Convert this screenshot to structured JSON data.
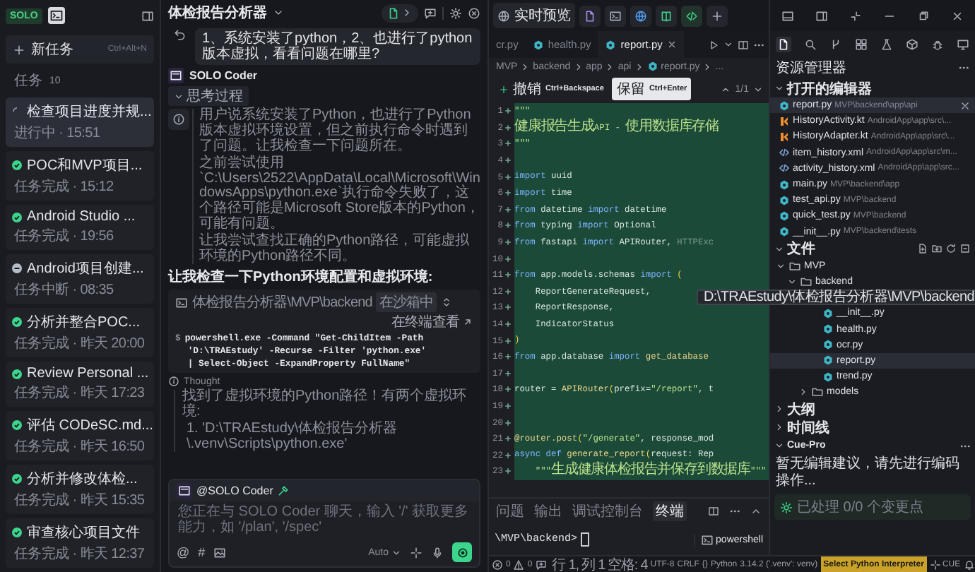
{
  "sidebar": {
    "logo": "SOLO",
    "new_task": {
      "label": "新任务",
      "shortcut": "Ctrl+Alt+N"
    },
    "tasks_label": "任务",
    "tasks_count": "10",
    "tasks": [
      {
        "title": "检查项目进度并规...",
        "status": "进行中 · 15:51",
        "kind": "running",
        "selected": true
      },
      {
        "title": "POC和MVP项目...",
        "status": "任务完成 · 15:12",
        "kind": "done",
        "selected": false
      },
      {
        "title": "Android Studio ...",
        "status": "任务完成 · 19:56",
        "kind": "done",
        "selected": false
      },
      {
        "title": "Android项目创建...",
        "status": "任务中断 · 08:35",
        "kind": "stopped",
        "selected": false
      },
      {
        "title": "分析并整合POC...",
        "status": "任务完成 · 昨天 20:00",
        "kind": "done",
        "selected": false
      },
      {
        "title": "Review Personal ...",
        "status": "任务完成 · 昨天 17:23",
        "kind": "done",
        "selected": false
      },
      {
        "title": "评估 CODeSC.md...",
        "status": "任务完成 · 昨天 16:50",
        "kind": "done",
        "selected": false
      },
      {
        "title": "分析并修改体检...",
        "status": "任务完成 · 昨天 15:35",
        "kind": "done",
        "selected": false
      },
      {
        "title": "审查核心项目文件",
        "status": "任务完成 · 昨天 12:37",
        "kind": "done",
        "selected": false
      }
    ]
  },
  "chat": {
    "title": "体检报告分析器",
    "user_message": "1、系统安装了python，2、也进行了python版本虚拟，看看问题在哪里?",
    "agent": "SOLO Coder",
    "thinking": {
      "label": "思考过程",
      "expanded": true,
      "paragraphs": [
        "用户说系统安装了Python，也进行了Python版本虚拟环境设置，但之前执行命令时遇到了问题。让我检查一下问题所在。",
        "之前尝试使用`C:\\Users\\2522\\AppData\\Local\\Microsoft\\WindowsApps\\python.exe`执行命令失败了，这个路径可能是Microsoft Store版本的Python，可能有问题。",
        "让我尝试查找正确的Python路径，可能虚拟环境的Python路径不同。"
      ]
    },
    "message": "让我检查一下Python环境配置和虚拟环境:",
    "terminal": {
      "path": "体检报告分析器\\MVP\\backend",
      "badge": "在沙箱中",
      "open_label": "在终端查看",
      "prompt": "$",
      "command_lines": [
        "powershell.exe -Command \"Get-ChildItem -Path",
        "'D:\\TRAEstudy' -Recurse -Filter 'python.exe'",
        "| Select-Object -ExpandProperty FullName\""
      ]
    },
    "thought": {
      "label": "Thought",
      "text": "找到了虚拟环境的Python路径！有两个虚拟环境:",
      "items": [
        "1. 'D:\\TRAEstudy\\体检报告分析器\\.venv\\Scripts\\python.exe'"
      ]
    },
    "input": {
      "mention": "@SOLO Coder",
      "placeholder": "您正在与 SOLO Coder 聊天，输入 '/' 获取更多能力，如 '/plan', '/spec'",
      "tools": [
        "@",
        "#"
      ],
      "mode": "Auto"
    }
  },
  "editor": {
    "preview": "实时预览",
    "tabs": [
      {
        "label": "cr.py",
        "selected": false
      },
      {
        "label": "health.py",
        "kind": "py",
        "selected": false
      },
      {
        "label": "report.py",
        "kind": "py",
        "selected": true
      }
    ],
    "breadcrumb": [
      "MVP",
      "backend",
      "app",
      "api",
      "report.py",
      "..."
    ],
    "diff": {
      "undo": "撤销",
      "undo_key": "Ctrl+Backspace",
      "keep": "保留",
      "keep_key": "Ctrl+Enter",
      "counter": "1/1"
    },
    "lines": [
      {
        "n": "1",
        "added": true,
        "segs": [
          {
            "kind": "str",
            "t": "\"\"\""
          }
        ]
      },
      {
        "n": "2",
        "added": true,
        "segs": [
          {
            "kind": "str",
            "t": "健康报告生成"
          },
          {
            "kind": "str",
            "t": "API - "
          },
          {
            "kind": "str",
            "t": "使用数据库存储"
          }
        ]
      },
      {
        "n": "3",
        "added": true,
        "segs": [
          {
            "kind": "str",
            "t": "\"\"\""
          }
        ]
      },
      {
        "n": "4",
        "added": true
      },
      {
        "n": "5",
        "added": true,
        "segs": [
          {
            "kind": "kw",
            "t": "import "
          },
          {
            "kind": "name",
            "t": "uuid"
          }
        ]
      },
      {
        "n": "6",
        "added": true,
        "segs": [
          {
            "kind": "kw",
            "t": "import "
          },
          {
            "kind": "name",
            "t": "time"
          }
        ]
      },
      {
        "n": "7",
        "added": true,
        "segs": [
          {
            "kind": "kw",
            "t": "from "
          },
          {
            "kind": "name",
            "t": "datetime "
          },
          {
            "kind": "kw",
            "t": "import "
          },
          {
            "kind": "name",
            "t": "datetime"
          }
        ]
      },
      {
        "n": "8",
        "added": true,
        "segs": [
          {
            "kind": "kw",
            "t": "from "
          },
          {
            "kind": "name",
            "t": "typing "
          },
          {
            "kind": "kw",
            "t": "import "
          },
          {
            "kind": "name",
            "t": "Optional"
          }
        ]
      },
      {
        "n": "9",
        "added": true,
        "segs": [
          {
            "kind": "kw",
            "t": "from "
          },
          {
            "kind": "name",
            "t": "fastapi "
          },
          {
            "kind": "kw",
            "t": "import "
          },
          {
            "kind": "name",
            "t": "APIRouter, "
          },
          {
            "kind": "dim",
            "t": "HTTPExc"
          }
        ]
      },
      {
        "n": "10",
        "added": true
      },
      {
        "n": "11",
        "added": true,
        "segs": [
          {
            "kind": "kw",
            "t": "from "
          },
          {
            "kind": "name",
            "t": "app.models.schemas "
          },
          {
            "kind": "kw",
            "t": "import "
          },
          {
            "kind": "punct",
            "t": "("
          }
        ]
      },
      {
        "n": "12",
        "added": true,
        "segs": [
          {
            "kind": "name",
            "t": "    ReportGenerateRequest,"
          }
        ]
      },
      {
        "n": "13",
        "added": true,
        "segs": [
          {
            "kind": "name",
            "t": "    ReportResponse,"
          }
        ]
      },
      {
        "n": "14",
        "added": true,
        "segs": [
          {
            "kind": "name",
            "t": "    IndicatorStatus"
          }
        ]
      },
      {
        "n": "15",
        "added": true,
        "segs": [
          {
            "kind": "punct",
            "t": ")"
          }
        ]
      },
      {
        "n": "16",
        "added": true,
        "segs": [
          {
            "kind": "kw",
            "t": "from "
          },
          {
            "kind": "name",
            "t": "app.database "
          },
          {
            "kind": "kw",
            "t": "import "
          },
          {
            "kind": "fn",
            "t": "get_database"
          }
        ]
      },
      {
        "n": "17",
        "added": true
      },
      {
        "n": "18",
        "added": true,
        "segs": [
          {
            "kind": "name",
            "t": "router = "
          },
          {
            "kind": "fn",
            "t": "APIRouter"
          },
          {
            "kind": "punct",
            "t": "("
          },
          {
            "kind": "name",
            "t": "prefix="
          },
          {
            "kind": "str",
            "t": "\"/report\""
          },
          {
            "kind": "name",
            "t": ", t"
          }
        ]
      },
      {
        "n": "19",
        "added": true
      },
      {
        "n": "20",
        "added": true
      },
      {
        "n": "21",
        "added": true,
        "segs": [
          {
            "kind": "fn",
            "t": "@router.post"
          },
          {
            "kind": "punct",
            "t": "("
          },
          {
            "kind": "str",
            "t": "\"/generate\""
          },
          {
            "kind": "name",
            "t": ", response_mod"
          }
        ]
      },
      {
        "n": "22",
        "added": true,
        "segs": [
          {
            "kind": "kw",
            "t": "async def "
          },
          {
            "kind": "fn",
            "t": "generate_report"
          },
          {
            "kind": "punct",
            "t": "("
          },
          {
            "kind": "name",
            "t": "request: Rep"
          }
        ]
      },
      {
        "n": "23",
        "added": true,
        "segs": [
          {
            "kind": "str",
            "t": "    \"\"\""
          },
          {
            "kind": "str",
            "t": "生成健康体检报告并保存到数据库"
          },
          {
            "kind": "str",
            "t": "\"\"\""
          }
        ]
      }
    ],
    "panel": {
      "tabs": [
        {
          "label": "问题",
          "selected": false
        },
        {
          "label": "输出",
          "selected": false
        },
        {
          "label": "调试控制台",
          "selected": false
        },
        {
          "label": "终端",
          "selected": true
        }
      ],
      "prompt": "\\MVP\\backend>",
      "shell": "powershell"
    }
  },
  "explorer": {
    "title": "资源管理器",
    "open_editors": {
      "label": "打开的编辑器",
      "expanded": true,
      "items": [
        {
          "name": "report.py",
          "path": "MVP\\backend\\app\\api",
          "kind": "py",
          "selected": true
        },
        {
          "name": "HistoryActivity.kt",
          "path": "AndroidApp\\app\\src\\...",
          "kind": "kt",
          "selected": false
        },
        {
          "name": "HistoryAdapter.kt",
          "path": "AndroidApp\\app\\src\\...",
          "kind": "kt",
          "selected": false
        },
        {
          "name": "item_history.xml",
          "path": "AndroidApp\\app\\src\\m...",
          "kind": "xml",
          "selected": false
        },
        {
          "name": "activity_history.xml",
          "path": "AndroidApp\\app\\src...",
          "kind": "xml",
          "selected": false
        },
        {
          "name": "main.py",
          "path": "MVP\\backend\\app",
          "kind": "py",
          "selected": false
        },
        {
          "name": "test_api.py",
          "path": "MVP\\backend",
          "kind": "py",
          "selected": false
        },
        {
          "name": "quick_test.py",
          "path": "MVP\\backend",
          "kind": "py",
          "selected": false
        },
        {
          "name": "__init__.py",
          "path": "MVP\\backend\\tests",
          "kind": "py",
          "selected": false
        }
      ]
    },
    "files": {
      "label": "文件",
      "expanded": true,
      "tooltip": "D:\\TRAEstudy\\体检报告分析器\\MVP\\backend",
      "tree": [
        {
          "name": "MVP",
          "kind": "folder",
          "expanded": true,
          "selected": false,
          "children": [
            {
              "name": "backend",
              "kind": "folder",
              "expanded": true,
              "selected": false,
              "children": [
                {
                  "children": [
                    {
                      "name": "__init__.py",
                      "kind": "py",
                      "selected": false
                    },
                    {
                      "name": "health.py",
                      "kind": "py",
                      "selected": false
                    },
                    {
                      "name": "ocr.py",
                      "kind": "py",
                      "selected": false
                    },
                    {
                      "name": "report.py",
                      "kind": "py",
                      "selected": true
                    },
                    {
                      "name": "trend.py",
                      "kind": "py",
                      "selected": false
                    }
                  ]
                },
                {
                  "name": "models",
                  "kind": "folder",
                  "expanded": false,
                  "selected": false
                }
              ]
            }
          ]
        }
      ]
    },
    "outline": {
      "label": "大纲",
      "expanded": false
    },
    "timeline": {
      "label": "时间线",
      "expanded": false
    },
    "cue": {
      "label": "Cue-Pro",
      "expanded": true,
      "message": "暂无编辑建议，请先进行编码操作...",
      "status": "已处理 0/0 个变更点"
    }
  },
  "status_bar": {
    "errors": "0",
    "warnings": "0",
    "position": "行 1, 列 1",
    "spaces": "空格: 4",
    "encoding": "UTF-8",
    "eol": "CRLF",
    "braces": "{}",
    "language": "Python",
    "version": "3.14.2 ('.venv': venv)",
    "interpreter": "Select Python Interpreter",
    "cue": "CUE"
  }
}
